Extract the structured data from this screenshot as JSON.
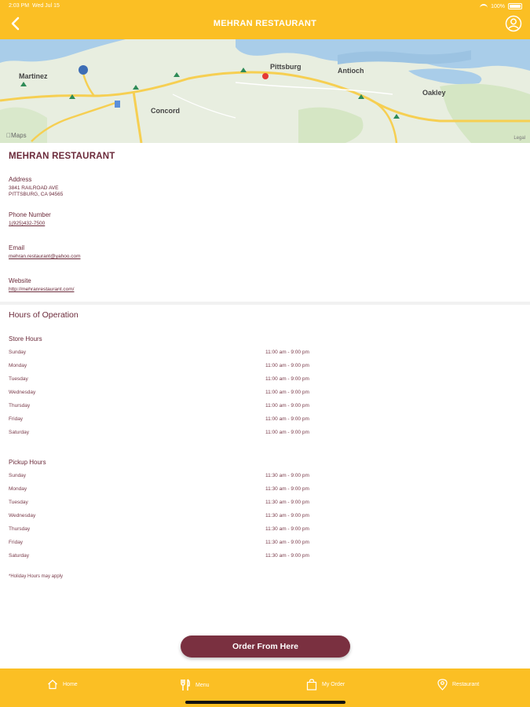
{
  "status_bar": {
    "time": "2:03 PM",
    "date": "Wed Jul 15",
    "battery": "100%"
  },
  "header": {
    "title": "MEHRAN RESTAURANT"
  },
  "map": {
    "labels": {
      "martinez": "Martinez",
      "concord": "Concord",
      "pittsburg": "Pittsburg",
      "antioch": "Antioch",
      "oakley": "Oakley"
    },
    "provider": "Maps",
    "legal": "Legal"
  },
  "restaurant": {
    "name": "MEHRAN RESTAURANT",
    "address_label": "Address",
    "address_line1": "3841 RAILROAD AVE",
    "address_line2": "PITTSBURG, CA 94565",
    "phone_label": "Phone Number",
    "phone": "1(925)432-7500",
    "email_label": "Email",
    "email": "mehran.restaurant@yahoo.com",
    "website_label": "Website",
    "website": "http://mehranrestaurant.com/"
  },
  "hours": {
    "title": "Hours of Operation",
    "store_title": "Store Hours",
    "store": [
      {
        "day": "Sunday",
        "time": "11:00 am - 9:00 pm"
      },
      {
        "day": "Monday",
        "time": "11:00 am - 9:00 pm"
      },
      {
        "day": "Tuesday",
        "time": "11:00 am - 9:00 pm"
      },
      {
        "day": "Wednesday",
        "time": "11:00 am - 9:00 pm"
      },
      {
        "day": "Thursday",
        "time": "11:00 am - 9:00 pm"
      },
      {
        "day": "Friday",
        "time": "11:00 am - 9:00 pm"
      },
      {
        "day": "Saturday",
        "time": "11:00 am - 9:00 pm"
      }
    ],
    "pickup_title": "Pickup Hours",
    "pickup": [
      {
        "day": "Sunday",
        "time": "11:30 am - 9:00 pm"
      },
      {
        "day": "Monday",
        "time": "11:30 am - 9:00 pm"
      },
      {
        "day": "Tuesday",
        "time": "11:30 am - 9:00 pm"
      },
      {
        "day": "Wednesday",
        "time": "11:30 am - 9:00 pm"
      },
      {
        "day": "Thursday",
        "time": "11:30 am - 9:00 pm"
      },
      {
        "day": "Friday",
        "time": "11:30 am - 9:00 pm"
      },
      {
        "day": "Saturday",
        "time": "11:30 am - 9:00 pm"
      }
    ],
    "note": "*Holiday Hours may apply"
  },
  "order_button": "Order From Here",
  "tabs": {
    "home": "Home",
    "menu": "Menu",
    "my_order": "My Order",
    "restaurant": "Restaurant"
  },
  "colors": {
    "accent": "#fbbf24",
    "brand": "#7a3040",
    "text": "#6b2a3a"
  }
}
